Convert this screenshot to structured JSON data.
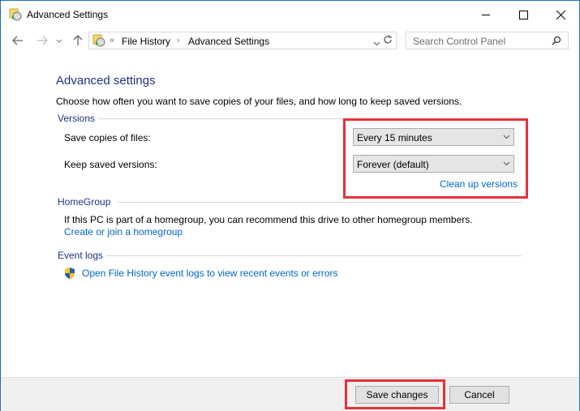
{
  "window": {
    "title": "Advanced Settings"
  },
  "titlebar": {
    "minimize_icon": "minimize-icon",
    "maximize_icon": "maximize-icon",
    "close_icon": "close-icon"
  },
  "navbar": {
    "back_icon": "arrow-left-icon",
    "forward_icon": "arrow-right-icon",
    "recent_icon": "chevron-down-icon",
    "up_icon": "arrow-up-icon",
    "breadcrumb": {
      "overflow": "«",
      "items": [
        "File History",
        "Advanced Settings"
      ]
    },
    "refresh_icon": "refresh-icon",
    "search": {
      "placeholder": "Search Control Panel",
      "icon": "search-icon"
    }
  },
  "main": {
    "heading": "Advanced settings",
    "description": "Choose how often you want to save copies of your files, and how long to keep saved versions.",
    "versions": {
      "group_label": "Versions",
      "save_copies_label": "Save copies of files:",
      "save_copies_value": "Every 15 minutes",
      "keep_versions_label": "Keep saved versions:",
      "keep_versions_value": "Forever (default)",
      "clean_up_link": "Clean up versions"
    },
    "homegroup": {
      "group_label": "HomeGroup",
      "text": "If this PC is part of a homegroup, you can recommend this drive to other homegroup members.",
      "link": "Create or join a homegroup"
    },
    "event_logs": {
      "group_label": "Event logs",
      "link": "Open File History event logs to view recent events or errors"
    }
  },
  "footer": {
    "save_label": "Save changes",
    "cancel_label": "Cancel"
  },
  "colors": {
    "heading": "#1e3287",
    "link": "#0066cc",
    "highlight": "#e8303a"
  }
}
